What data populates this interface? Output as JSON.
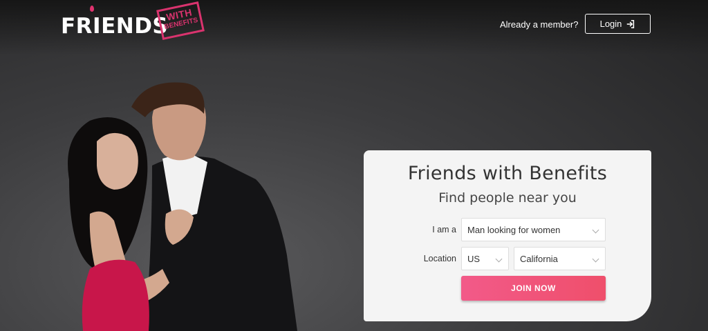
{
  "header": {
    "logo_main": "FRIENDS",
    "logo_stamp_line1": "WITH",
    "logo_stamp_line2": "BENEFITS",
    "member_prompt": "Already a member?",
    "login_label": "Login",
    "login_icon": "sign-in-icon"
  },
  "form": {
    "title": "Friends with Benefits",
    "subtitle": "Find people near you",
    "iam_label": "I am a",
    "iam_value": "Man looking for women",
    "location_label": "Location",
    "country_value": "US",
    "region_value": "California",
    "join_label": "JOIN NOW"
  },
  "colors": {
    "accent": "#e0336f",
    "button_gradient_start": "#f25a89",
    "button_gradient_end": "#ef4f6b",
    "background_dark": "#232324",
    "card_bg": "#f4f4f4"
  }
}
